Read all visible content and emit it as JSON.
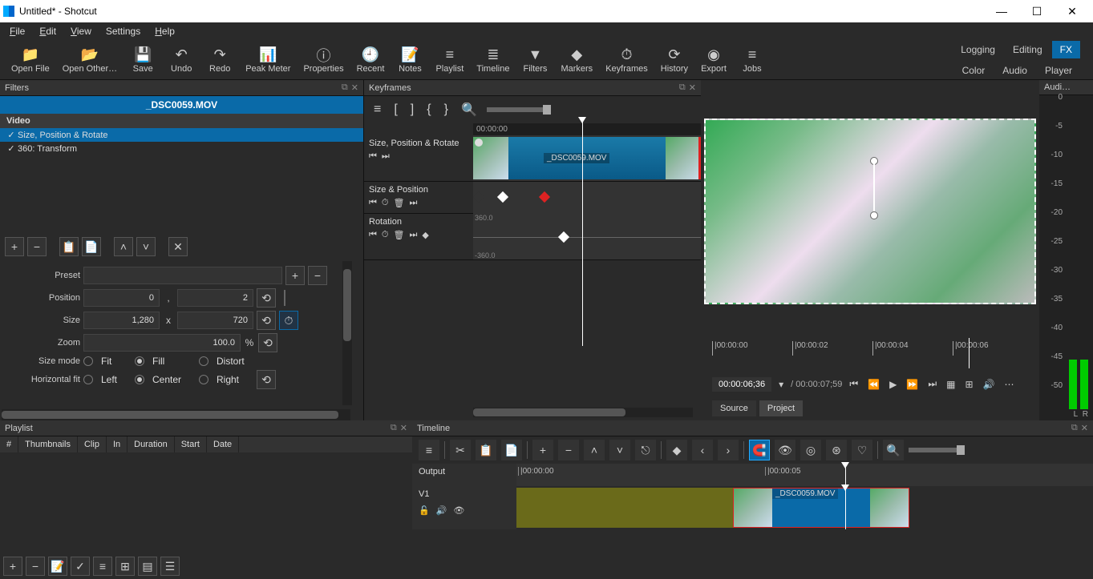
{
  "window": {
    "title": "Untitled* - Shotcut"
  },
  "menu": {
    "file": "File",
    "edit": "Edit",
    "view": "View",
    "settings": "Settings",
    "help": "Help"
  },
  "toolbar": {
    "items": [
      {
        "label": "Open File",
        "icon": "📁"
      },
      {
        "label": "Open Other…",
        "icon": "📂"
      },
      {
        "label": "Save",
        "icon": "💾"
      },
      {
        "label": "Undo",
        "icon": "↶"
      },
      {
        "label": "Redo",
        "icon": "↷"
      },
      {
        "label": "Peak Meter",
        "icon": "📊"
      },
      {
        "label": "Properties",
        "icon": "ⓘ"
      },
      {
        "label": "Recent",
        "icon": "🕘"
      },
      {
        "label": "Notes",
        "icon": "📝"
      },
      {
        "label": "Playlist",
        "icon": "≡"
      },
      {
        "label": "Timeline",
        "icon": "≣"
      },
      {
        "label": "Filters",
        "icon": "▼"
      },
      {
        "label": "Markers",
        "icon": "◆"
      },
      {
        "label": "Keyframes",
        "icon": "⏱"
      },
      {
        "label": "History",
        "icon": "⟳"
      },
      {
        "label": "Export",
        "icon": "◉"
      },
      {
        "label": "Jobs",
        "icon": "≡"
      }
    ],
    "modes_top": [
      "Logging",
      "Editing",
      "FX"
    ],
    "modes_bottom": [
      "Color",
      "Audio",
      "Player"
    ],
    "mode_active": "FX"
  },
  "filters": {
    "title": "Filters",
    "clip": "_DSC0059.MOV",
    "category": "Video",
    "list": [
      {
        "checked": true,
        "name": "Size, Position & Rotate",
        "selected": true
      },
      {
        "checked": true,
        "name": "360: Transform",
        "selected": false
      }
    ],
    "form": {
      "preset": "Preset",
      "position": "Position",
      "pos_x": "0",
      "pos_y": "2",
      "size": "Size",
      "size_w": "1,280",
      "size_h": "720",
      "zoom": "Zoom",
      "zoom_val": "100.0",
      "zoom_unit": "%",
      "sizemode": "Size mode",
      "fit": "Fit",
      "fill": "Fill",
      "distort": "Distort",
      "hfit": "Horizontal fit",
      "left": "Left",
      "center": "Center",
      "right": "Right"
    }
  },
  "keyframes": {
    "title": "Keyframes",
    "time": "00:00:00",
    "track_name": "Size, Position & Rotate",
    "clip_label": "_DSC0059.MOV",
    "param1": "Size & Position",
    "param2": "Rotation",
    "scale_top": "360.0",
    "scale_bot": "-360.0"
  },
  "preview": {
    "ticks": [
      "|00:00:00",
      "|00:00:02",
      "|00:00:04",
      "|00:00:06"
    ],
    "timecode": "00:00:06;36",
    "duration": "/ 00:00:07;59",
    "source": "Source",
    "project": "Project"
  },
  "audio": {
    "title": "Audi…",
    "dbs": [
      "0",
      "-5",
      "-10",
      "-15",
      "-20",
      "-25",
      "-30",
      "-35",
      "-40",
      "-45",
      "-50"
    ],
    "L": "L",
    "R": "R"
  },
  "playlist": {
    "title": "Playlist",
    "cols": [
      "#",
      "Thumbnails",
      "Clip",
      "In",
      "Duration",
      "Start",
      "Date"
    ]
  },
  "timeline": {
    "title": "Timeline",
    "output": "Output",
    "track": "V1",
    "ticks": [
      "|00:00:00",
      "|00:00:05"
    ],
    "clip_label": "_DSC0059.MOV"
  }
}
